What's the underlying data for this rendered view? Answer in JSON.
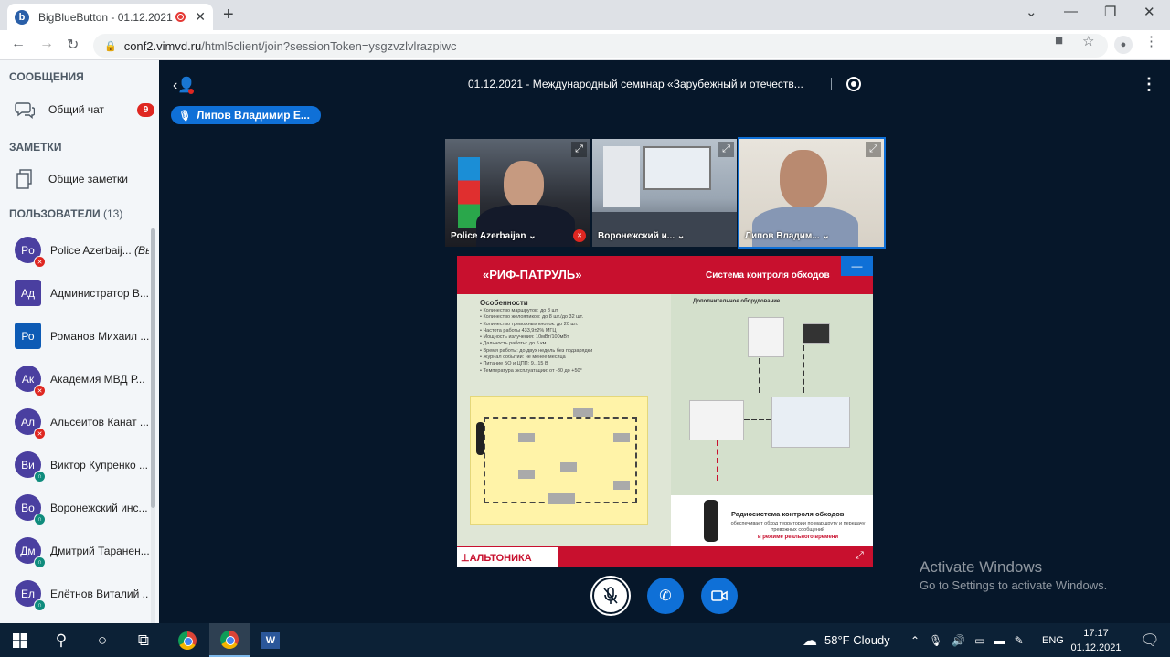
{
  "browser": {
    "tab_title": "BigBlueButton - 01.12.2021",
    "url_host": "conf2.vimvd.ru",
    "url_path": "/html5client/join?sessionToken=ysgzvzlvlrazpiwc"
  },
  "sidebar": {
    "messages_header": "СООБЩЕНИЯ",
    "public_chat_label": "Общий чат",
    "public_chat_unread": "9",
    "notes_header": "ЗАМЕТКИ",
    "shared_notes_label": "Общие заметки",
    "users_header": "ПОЛЬЗОВАТЕЛИ",
    "users_count": "(13)",
    "users": [
      {
        "initials": "Po",
        "name": "Police Azerbaij...",
        "suffix": "(Вы)",
        "color": "#4a3fa0",
        "status": "muted",
        "shape": "round"
      },
      {
        "initials": "Ад",
        "name": "Администратор В...",
        "suffix": "",
        "color": "#4a3fa0",
        "status": "",
        "shape": "square"
      },
      {
        "initials": "Ро",
        "name": "Романов Михаил ...",
        "suffix": "",
        "color": "#0d5bb5",
        "status": "",
        "shape": "square"
      },
      {
        "initials": "Ак",
        "name": "Академия МВД Р...",
        "suffix": "",
        "color": "#4a3fa0",
        "status": "muted",
        "shape": "round"
      },
      {
        "initials": "Ал",
        "name": "Альсеитов Канат ...",
        "suffix": "",
        "color": "#4a3fa0",
        "status": "muted",
        "shape": "round"
      },
      {
        "initials": "Ви",
        "name": "Виктор Купренко ...",
        "suffix": "",
        "color": "#4a3fa0",
        "status": "listen",
        "shape": "round"
      },
      {
        "initials": "Во",
        "name": "Воронежский инс...",
        "suffix": "",
        "color": "#4a3fa0",
        "status": "listen",
        "shape": "round"
      },
      {
        "initials": "Дм",
        "name": "Дмитрий Таранен...",
        "suffix": "",
        "color": "#4a3fa0",
        "status": "listen",
        "shape": "round"
      },
      {
        "initials": "Ел",
        "name": "Елётнов Виталий ...",
        "suffix": "",
        "color": "#4a3fa0",
        "status": "listen",
        "shape": "round"
      }
    ]
  },
  "main": {
    "meeting_title": "01.12.2021 - Международный семинар «Зарубежный и отечеств...",
    "talking_indicator": "Липов Владимир Е...",
    "videos": [
      {
        "name": "Police Azerbaijan",
        "muted": true
      },
      {
        "name": "Воронежский и...",
        "muted": false
      },
      {
        "name": "Липов Владим...",
        "muted": false
      }
    ],
    "slide": {
      "title_left": "«РИФ-ПАТРУЛЬ»",
      "title_right": "Система контроля обходов",
      "features_title": "Особенности",
      "features": [
        "Количество маршрутов: до 8 шт.",
        "Количество желояпиков: до 8 шт./до 32 шт.",
        "Количество тревожных кнопок: до 20 шт.",
        "Частота работы 433,9±2% МГЦ",
        "Мощность излучения: 10мВт/100мВт",
        "Дальность работы: до 5 км",
        "Время работы: до двух недель без подзарядки",
        "Журнал событий: не менее месяца",
        "Питание БО и ЦПП: 9...15 В",
        "Температура эксплуатации: от -30 до +50°"
      ],
      "equip_title": "Дополнительное оборудование",
      "radio_title": "Радиосистема контроля обходов",
      "radio_text": "обеспечивает обход территории по маршруту и передачу тревожных сообщений",
      "radio_highlight": "в режиме реального времени",
      "logo": "АЛЬТОНИКА"
    }
  },
  "watermark": {
    "line1": "Activate Windows",
    "line2": "Go to Settings to activate Windows."
  },
  "taskbar": {
    "weather": "58°F  Cloudy",
    "lang": "ENG",
    "time": "17:17",
    "date": "01.12.2021"
  },
  "colors": {
    "accent": "#0f70d7",
    "main_bg": "#06172a",
    "danger": "#df2721",
    "slide_red": "#c8102e"
  }
}
